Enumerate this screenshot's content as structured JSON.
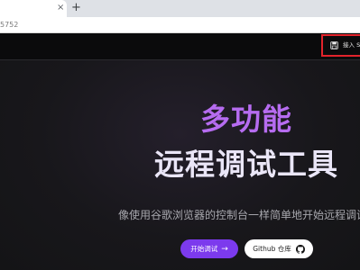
{
  "browser": {
    "tab_close": "×",
    "new_tab": "+",
    "address_fragment": "5752"
  },
  "header": {
    "login_label": "接入 S"
  },
  "hero": {
    "title_line1": "多功能",
    "title_line2": "远程调试工具",
    "subtitle": "像使用谷歌浏览器的控制台一样简单地开始远程调试",
    "start_button": "开始调试",
    "start_arrow": "→",
    "github_button": "Github 仓库"
  },
  "colors": {
    "title_accent": "#b66cf0",
    "primary_button": "#7c3aed",
    "highlight_border": "#e3232b"
  },
  "icons": [
    "close-icon",
    "plus-icon",
    "save-icon",
    "arrow-right-icon",
    "github-icon"
  ]
}
